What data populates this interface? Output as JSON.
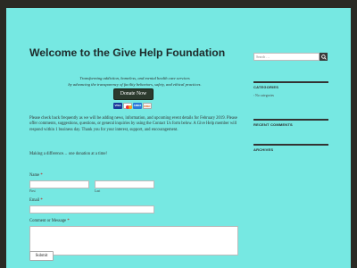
{
  "main": {
    "title": "Welcome to the Give Help Foundation",
    "tagline_line1": "Transforming addiction, homeless, and mental health care services",
    "tagline_line2": "by advancing the transparency of facility behaviors, safety, and ethical practices.",
    "donate_label": "Donate Now",
    "cards": [
      "VISA",
      "MC",
      "AMEX",
      "DISC"
    ],
    "body_text": "Please check back frequently as we will be adding news, information, and upcoming event details for February 2019. Please offer comments, suggestions, questions, or general inquiries by using the Contact Us form below. A Give Help member will respond within 1 business day. Thank you for your interest, support, and encouragement.",
    "making_difference": "Making a difference… one donation at a time!"
  },
  "form": {
    "name_label": "Name",
    "required_mark": "*",
    "first_label": "First",
    "last_label": "Last",
    "email_label": "Email",
    "message_label": "Comment or Message",
    "submit_label": "Submit"
  },
  "sidebar": {
    "search_placeholder": "Search …",
    "categories_title": "CATEGORIES",
    "categories_item": "No categories",
    "recent_comments_title": "RECENT COMMENTS",
    "archives_title": "ARCHIVES"
  },
  "colors": {
    "page_bg": "#76e8e2",
    "frame": "#2a2a24",
    "donate_bg": "#2c3a2e"
  }
}
